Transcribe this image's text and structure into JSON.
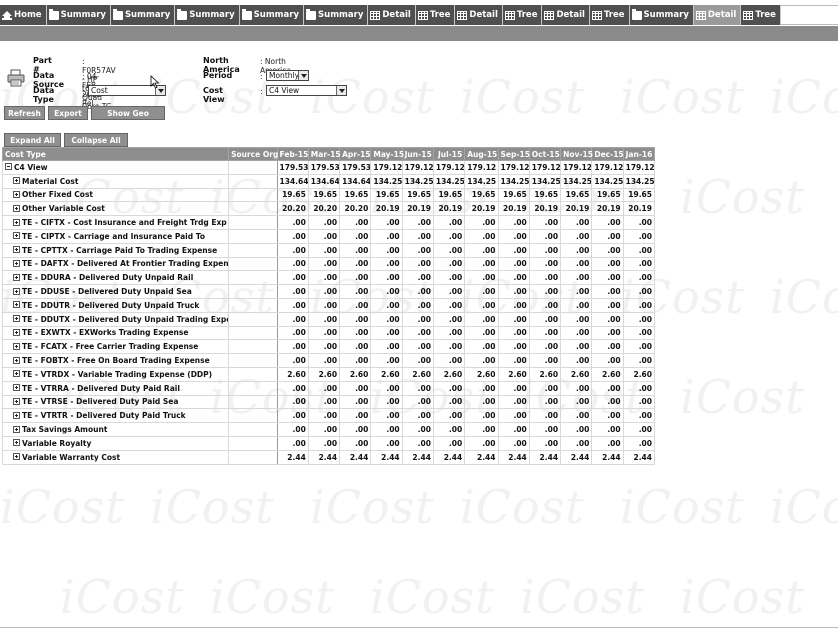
{
  "tabs": [
    {
      "label": "Home",
      "icon": "home-icon",
      "active": false
    },
    {
      "label": "Summary",
      "icon": "folder-icon",
      "active": false
    },
    {
      "label": "Summary",
      "icon": "folder-icon",
      "active": false
    },
    {
      "label": "Summary",
      "icon": "folder-icon",
      "active": false
    },
    {
      "label": "Summary",
      "icon": "folder-icon",
      "active": false
    },
    {
      "label": "Summary",
      "icon": "folder-icon",
      "active": false
    },
    {
      "label": "Detail",
      "icon": "grid-icon",
      "active": false
    },
    {
      "label": "Tree",
      "icon": "grid-icon",
      "active": false
    },
    {
      "label": "Detail",
      "icon": "grid-icon",
      "active": false
    },
    {
      "label": "Tree",
      "icon": "grid-icon",
      "active": false
    },
    {
      "label": "Detail",
      "icon": "grid-icon",
      "active": false
    },
    {
      "label": "Tree",
      "icon": "grid-icon",
      "active": false
    },
    {
      "label": "Summary",
      "icon": "folder-icon",
      "active": false
    },
    {
      "label": "Detail",
      "icon": "grid-icon",
      "active": true
    },
    {
      "label": "Tree",
      "icon": "grid-icon",
      "active": false
    }
  ],
  "watermark": "iCost",
  "header": {
    "part_label": "Part #",
    "part_value": ": F0R57AV - HP t620 Quad Core TC",
    "region_label": "North America",
    "region_value": ": North America",
    "data_source_label": "Data Source",
    "data_source_value": ": 04-FEB-2015 Rel",
    "period_label": "Period",
    "period_value": "Monthly",
    "data_type_label": "Data Type",
    "data_type_value": "Cost",
    "cost_view_label": "Cost View",
    "cost_view_value": "C4 View",
    "colon": ":"
  },
  "buttons": {
    "refresh": "Refresh",
    "export": "Export",
    "show_geo_source": "Show Geo Source",
    "expand_all": "Expand All",
    "collapse_all": "Collapse All"
  },
  "table": {
    "columns": [
      "Cost Type",
      "Source Org",
      "Feb-15",
      "Mar-15",
      "Apr-15",
      "May-15",
      "Jun-15",
      "Jul-15",
      "Aug-15",
      "Sep-15",
      "Oct-15",
      "Nov-15",
      "Dec-15",
      "Jan-16"
    ],
    "rows": [
      {
        "name": "C4 View",
        "toggle": "minus",
        "level": 0,
        "values": [
          "179.53",
          "179.53",
          "179.53",
          "179.12",
          "179.12",
          "179.12",
          "179.12",
          "179.12",
          "179.12",
          "179.12",
          "179.12",
          "179.12"
        ]
      },
      {
        "name": "Material Cost",
        "toggle": "plus",
        "level": 1,
        "values": [
          "134.64",
          "134.64",
          "134.64",
          "134.25",
          "134.25",
          "134.25",
          "134.25",
          "134.25",
          "134.25",
          "134.25",
          "134.25",
          "134.25"
        ]
      },
      {
        "name": "Other Fixed Cost",
        "toggle": "plus",
        "level": 1,
        "values": [
          "19.65",
          "19.65",
          "19.65",
          "19.65",
          "19.65",
          "19.65",
          "19.65",
          "19.65",
          "19.65",
          "19.65",
          "19.65",
          "19.65"
        ]
      },
      {
        "name": "Other Variable Cost",
        "toggle": "plus",
        "level": 1,
        "values": [
          "20.20",
          "20.20",
          "20.20",
          "20.19",
          "20.19",
          "20.19",
          "20.19",
          "20.19",
          "20.19",
          "20.19",
          "20.19",
          "20.19"
        ]
      },
      {
        "name": "TE - CIFTX - Cost Insurance and Freight Trdg Exp",
        "toggle": "plus",
        "level": 1,
        "values": [
          ".00",
          ".00",
          ".00",
          ".00",
          ".00",
          ".00",
          ".00",
          ".00",
          ".00",
          ".00",
          ".00",
          ".00"
        ]
      },
      {
        "name": "TE - CIPTX - Carriage and Insurance Paid To",
        "toggle": "plus",
        "level": 1,
        "values": [
          ".00",
          ".00",
          ".00",
          ".00",
          ".00",
          ".00",
          ".00",
          ".00",
          ".00",
          ".00",
          ".00",
          ".00"
        ]
      },
      {
        "name": "TE - CPTTX - Carriage Paid To Trading Expense",
        "toggle": "plus",
        "level": 1,
        "values": [
          ".00",
          ".00",
          ".00",
          ".00",
          ".00",
          ".00",
          ".00",
          ".00",
          ".00",
          ".00",
          ".00",
          ".00"
        ]
      },
      {
        "name": "TE - DAFTX - Delivered At Frontier Trading Expense",
        "toggle": "plus",
        "level": 1,
        "values": [
          ".00",
          ".00",
          ".00",
          ".00",
          ".00",
          ".00",
          ".00",
          ".00",
          ".00",
          ".00",
          ".00",
          ".00"
        ]
      },
      {
        "name": "TE - DDURA - Delivered Duty Unpaid Rail",
        "toggle": "plus",
        "level": 1,
        "values": [
          ".00",
          ".00",
          ".00",
          ".00",
          ".00",
          ".00",
          ".00",
          ".00",
          ".00",
          ".00",
          ".00",
          ".00"
        ]
      },
      {
        "name": "TE - DDUSE - Delivered Duty Unpaid Sea",
        "toggle": "plus",
        "level": 1,
        "values": [
          ".00",
          ".00",
          ".00",
          ".00",
          ".00",
          ".00",
          ".00",
          ".00",
          ".00",
          ".00",
          ".00",
          ".00"
        ]
      },
      {
        "name": "TE - DDUTR - Delivered Duty Unpaid Truck",
        "toggle": "plus",
        "level": 1,
        "values": [
          ".00",
          ".00",
          ".00",
          ".00",
          ".00",
          ".00",
          ".00",
          ".00",
          ".00",
          ".00",
          ".00",
          ".00"
        ]
      },
      {
        "name": "TE - DDUTX - Delivered Duty Unpaid Trading Expense",
        "toggle": "plus",
        "level": 1,
        "values": [
          ".00",
          ".00",
          ".00",
          ".00",
          ".00",
          ".00",
          ".00",
          ".00",
          ".00",
          ".00",
          ".00",
          ".00"
        ]
      },
      {
        "name": "TE - EXWTX - EXWorks Trading Expense",
        "toggle": "plus",
        "level": 1,
        "values": [
          ".00",
          ".00",
          ".00",
          ".00",
          ".00",
          ".00",
          ".00",
          ".00",
          ".00",
          ".00",
          ".00",
          ".00"
        ]
      },
      {
        "name": "TE - FCATX - Free Carrier Trading Expense",
        "toggle": "plus",
        "level": 1,
        "values": [
          ".00",
          ".00",
          ".00",
          ".00",
          ".00",
          ".00",
          ".00",
          ".00",
          ".00",
          ".00",
          ".00",
          ".00"
        ]
      },
      {
        "name": "TE - FOBTX - Free On Board Trading Expense",
        "toggle": "plus",
        "level": 1,
        "values": [
          ".00",
          ".00",
          ".00",
          ".00",
          ".00",
          ".00",
          ".00",
          ".00",
          ".00",
          ".00",
          ".00",
          ".00"
        ]
      },
      {
        "name": "TE - VTRDX - Variable Trading Expense (DDP)",
        "toggle": "plus",
        "level": 1,
        "values": [
          "2.60",
          "2.60",
          "2.60",
          "2.60",
          "2.60",
          "2.60",
          "2.60",
          "2.60",
          "2.60",
          "2.60",
          "2.60",
          "2.60"
        ]
      },
      {
        "name": "TE - VTRRA - Delivered Duty Paid Rail",
        "toggle": "plus",
        "level": 1,
        "values": [
          ".00",
          ".00",
          ".00",
          ".00",
          ".00",
          ".00",
          ".00",
          ".00",
          ".00",
          ".00",
          ".00",
          ".00"
        ]
      },
      {
        "name": "TE - VTRSE - Delivered Duty Paid Sea",
        "toggle": "plus",
        "level": 1,
        "values": [
          ".00",
          ".00",
          ".00",
          ".00",
          ".00",
          ".00",
          ".00",
          ".00",
          ".00",
          ".00",
          ".00",
          ".00"
        ]
      },
      {
        "name": "TE - VTRTR - Delivered Duty Paid Truck",
        "toggle": "plus",
        "level": 1,
        "values": [
          ".00",
          ".00",
          ".00",
          ".00",
          ".00",
          ".00",
          ".00",
          ".00",
          ".00",
          ".00",
          ".00",
          ".00"
        ]
      },
      {
        "name": "Tax Savings Amount",
        "toggle": "plus",
        "level": 1,
        "values": [
          ".00",
          ".00",
          ".00",
          ".00",
          ".00",
          ".00",
          ".00",
          ".00",
          ".00",
          ".00",
          ".00",
          ".00"
        ]
      },
      {
        "name": "Variable Royalty",
        "toggle": "plus",
        "level": 1,
        "values": [
          ".00",
          ".00",
          ".00",
          ".00",
          ".00",
          ".00",
          ".00",
          ".00",
          ".00",
          ".00",
          ".00",
          ".00"
        ]
      },
      {
        "name": "Variable Warranty Cost",
        "toggle": "plus",
        "level": 1,
        "values": [
          "2.44",
          "2.44",
          "2.44",
          "2.44",
          "2.44",
          "2.44",
          "2.44",
          "2.44",
          "2.44",
          "2.44",
          "2.44",
          "2.44"
        ]
      }
    ]
  },
  "colors": {
    "tab_bg": "#4f4f4f",
    "tab_active_bg": "#9a9a9a",
    "header_band": "#8a8a8a",
    "table_header_bg": "#8e8e8e",
    "button_bg": "#8f8f8f"
  }
}
